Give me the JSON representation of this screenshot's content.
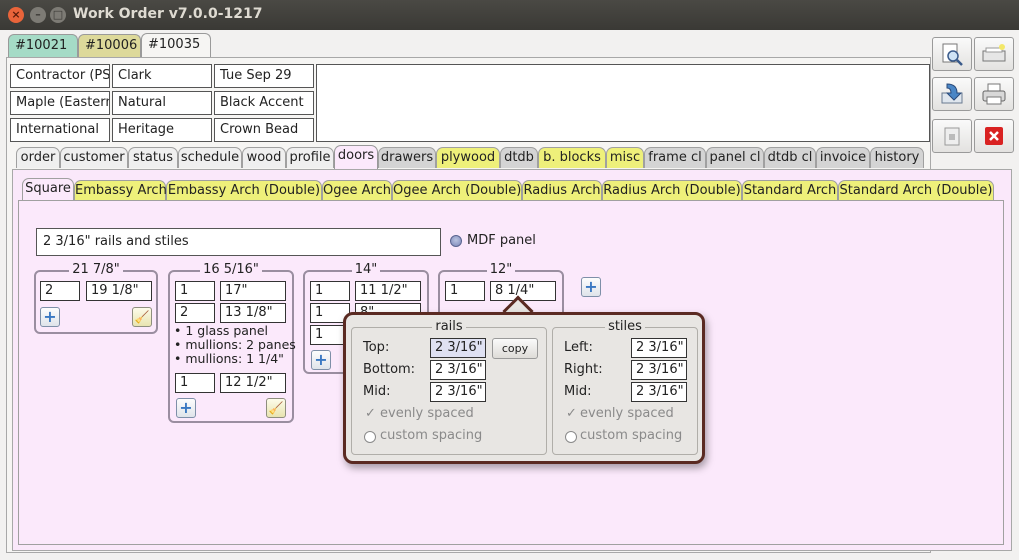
{
  "window": {
    "title": "Work Order v7.0.0-1217",
    "close_glyph": "×",
    "min_glyph": "–",
    "max_glyph": "□"
  },
  "order_tabs": [
    "#10021",
    "#10006",
    "#10035"
  ],
  "info": {
    "row1": [
      "Contractor (PST)",
      "Clark",
      "Tue Sep 29"
    ],
    "row2": [
      "Maple (Eastern)",
      "Natural",
      "Black Accent"
    ],
    "row3": [
      "International",
      "Heritage",
      "Crown Bead"
    ]
  },
  "toolbar_icons": [
    "preview-icon",
    "new-window-icon",
    "import-icon",
    "print-icon",
    "lock-icon",
    "delete-icon"
  ],
  "section_tabs": [
    "order",
    "customer",
    "status",
    "schedule",
    "wood",
    "profile",
    "doors",
    "drawers",
    "plywood",
    "dtdb",
    "b. blocks",
    "misc",
    "frame cl",
    "panel cl",
    "dtdb cl",
    "invoice",
    "history"
  ],
  "arch_tabs": [
    "Square",
    "Embassy Arch",
    "Embassy Arch (Double)",
    "Ogee Arch",
    "Ogee Arch (Double)",
    "Radius Arch",
    "Radius Arch (Double)",
    "Standard Arch",
    "Standard Arch (Double)"
  ],
  "door_spec": {
    "description": "2 3/16\" rails and stiles",
    "mdf_label": "MDF panel"
  },
  "doors": [
    {
      "width": "21 7/8\"",
      "rows": [
        [
          "2",
          "19 1/8\""
        ]
      ]
    },
    {
      "width": "16 5/16\"",
      "rows": [
        [
          "1",
          "17\""
        ],
        [
          "2",
          "13 1/8\""
        ],
        [
          "1",
          "12 1/2\""
        ]
      ],
      "notes": [
        "• 1 glass panel",
        "• mullions: 2 panes",
        "• mullions: 1 1/4\""
      ]
    },
    {
      "width": "14\"",
      "rows": [
        [
          "1",
          "11 1/2\""
        ],
        [
          "1",
          "8\""
        ],
        [
          "1",
          ""
        ]
      ]
    },
    {
      "width": "12\"",
      "rows": [
        [
          "1",
          "8 1/4\""
        ]
      ]
    }
  ],
  "popover": {
    "rails": {
      "title": "rails",
      "top_label": "Top:",
      "top_value": "2 3/16\"",
      "copy_label": "copy",
      "bottom_label": "Bottom:",
      "bottom_value": "2 3/16\"",
      "mid_label": "Mid:",
      "mid_value": "2 3/16\"",
      "evenly": "evenly spaced",
      "custom": "custom spacing"
    },
    "stiles": {
      "title": "stiles",
      "left_label": "Left:",
      "left_value": "2 3/16\"",
      "right_label": "Right:",
      "right_value": "2 3/16\"",
      "mid_label": "Mid:",
      "mid_value": "2 3/16\"",
      "evenly": "evenly spaced",
      "custom": "custom spacing"
    }
  },
  "glyphs": {
    "plus": "+",
    "broom": "🧹",
    "check": "✓"
  },
  "colors": {
    "accent_pink": "#fbe9fb",
    "tab_yellow": "#eef07a",
    "tab_teal": "#a5dbc6",
    "tab_khaki": "#ddd99a",
    "popover_border": "#5a2a22",
    "delete_red": "#d92222"
  }
}
